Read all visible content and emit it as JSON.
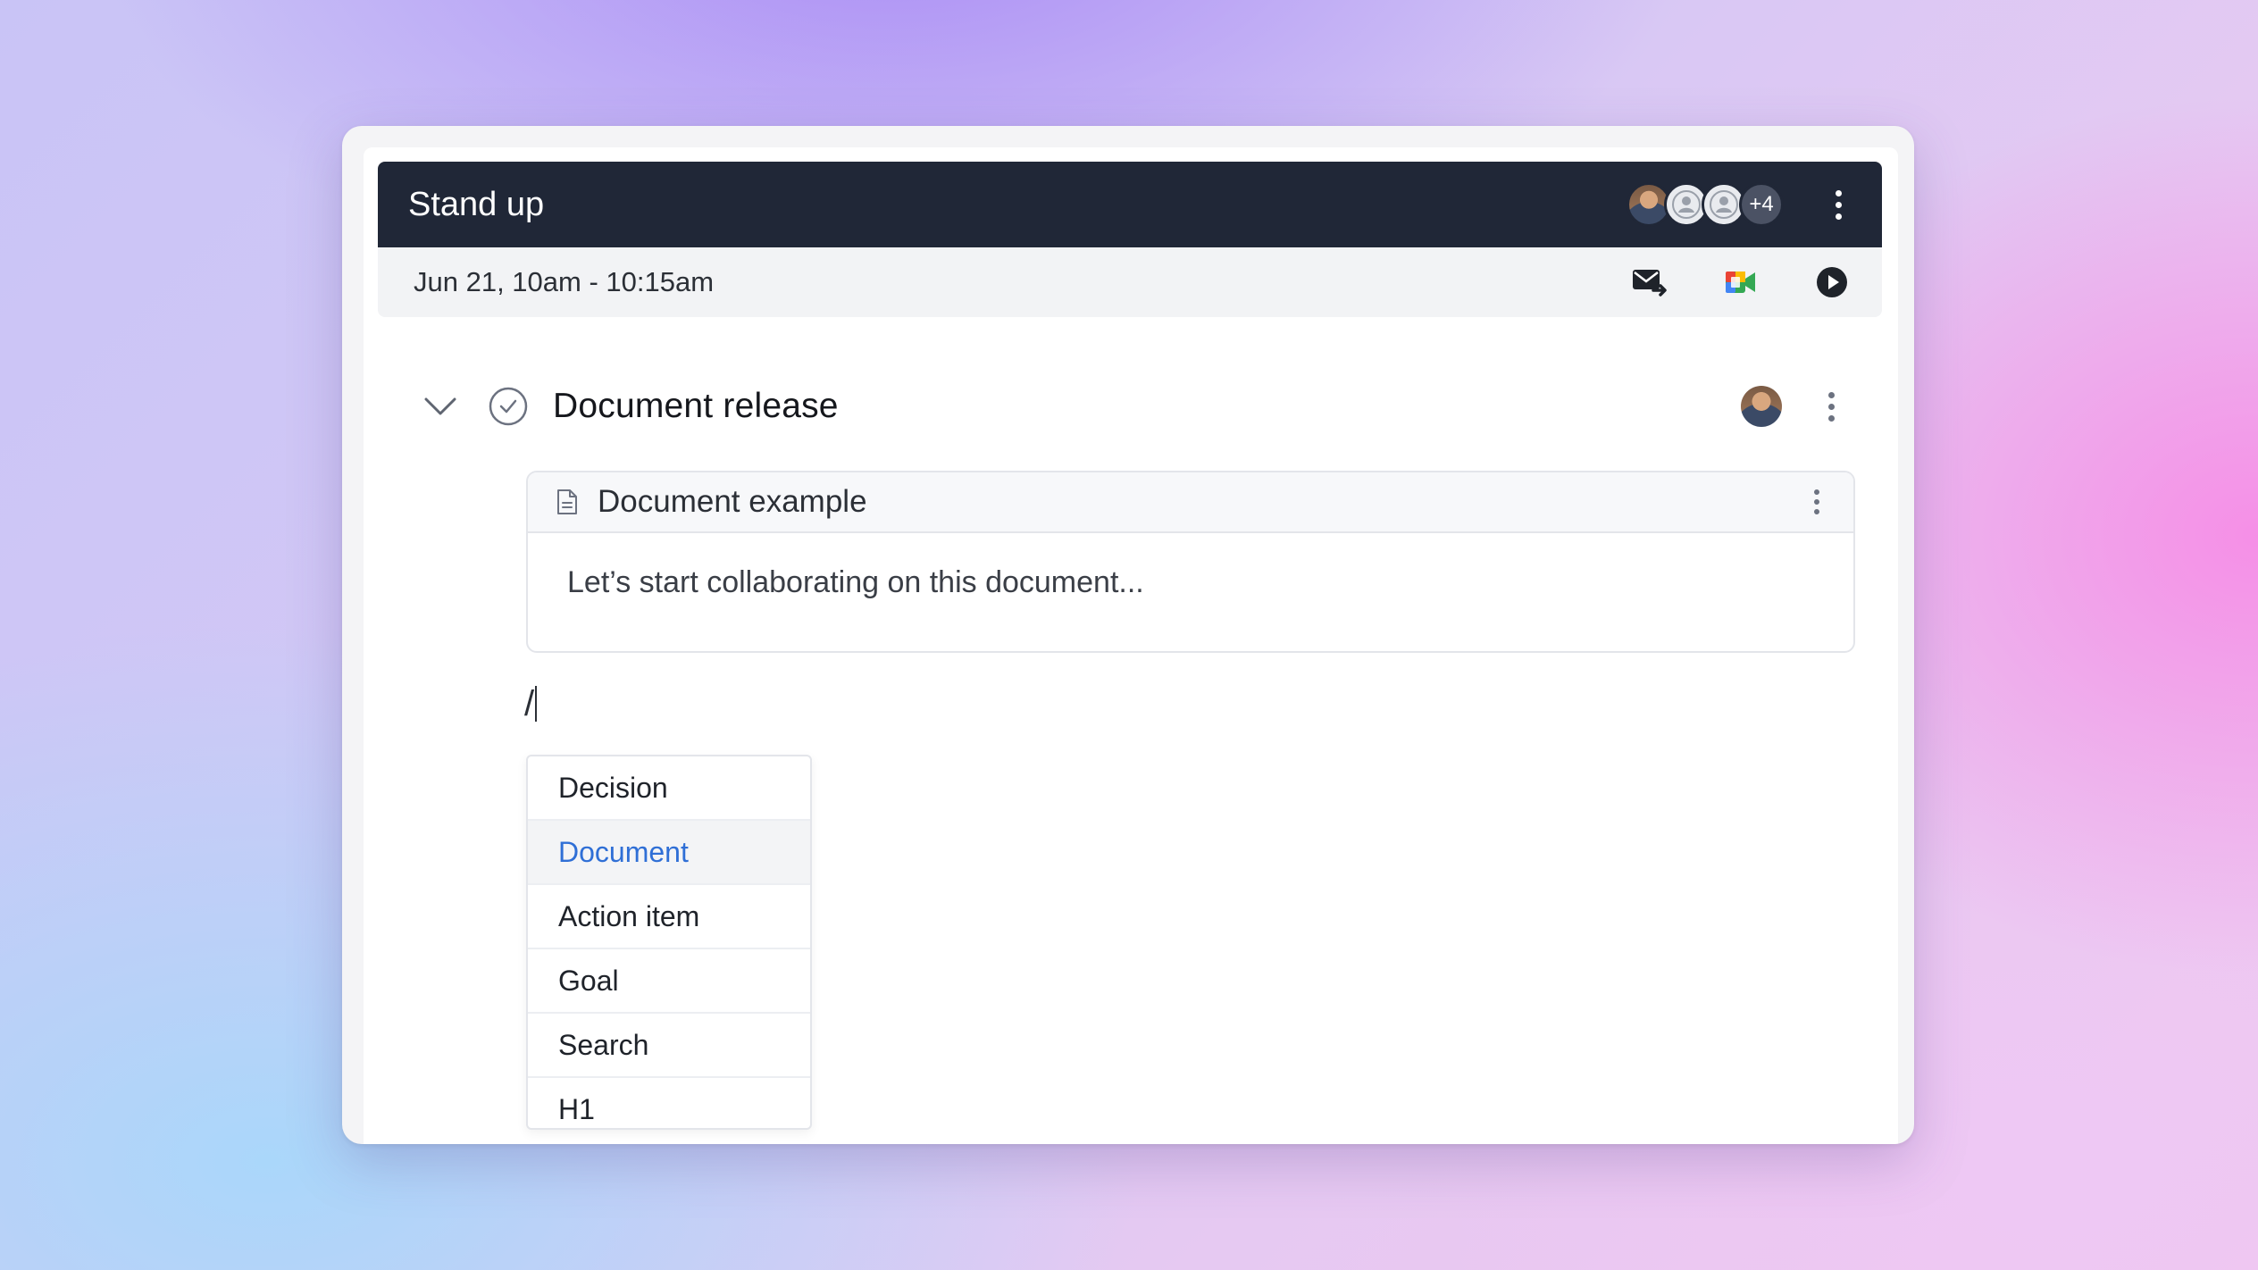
{
  "meeting": {
    "title": "Stand up",
    "time": "Jun 21, 10am - 10:15am",
    "extra_attendees": "+4"
  },
  "agenda_item": {
    "title": "Document release",
    "document": {
      "title": "Document example",
      "body": "Let’s start collaborating on this document..."
    }
  },
  "editor": {
    "slash_input": "/"
  },
  "slash_menu": {
    "items": [
      {
        "label": "Decision"
      },
      {
        "label": "Document"
      },
      {
        "label": "Action item"
      },
      {
        "label": "Goal"
      },
      {
        "label": "Search"
      },
      {
        "label": "H1"
      }
    ],
    "active_index": 1
  },
  "colors": {
    "header_bg": "#202737",
    "accent_blue": "#2f6fd6"
  }
}
